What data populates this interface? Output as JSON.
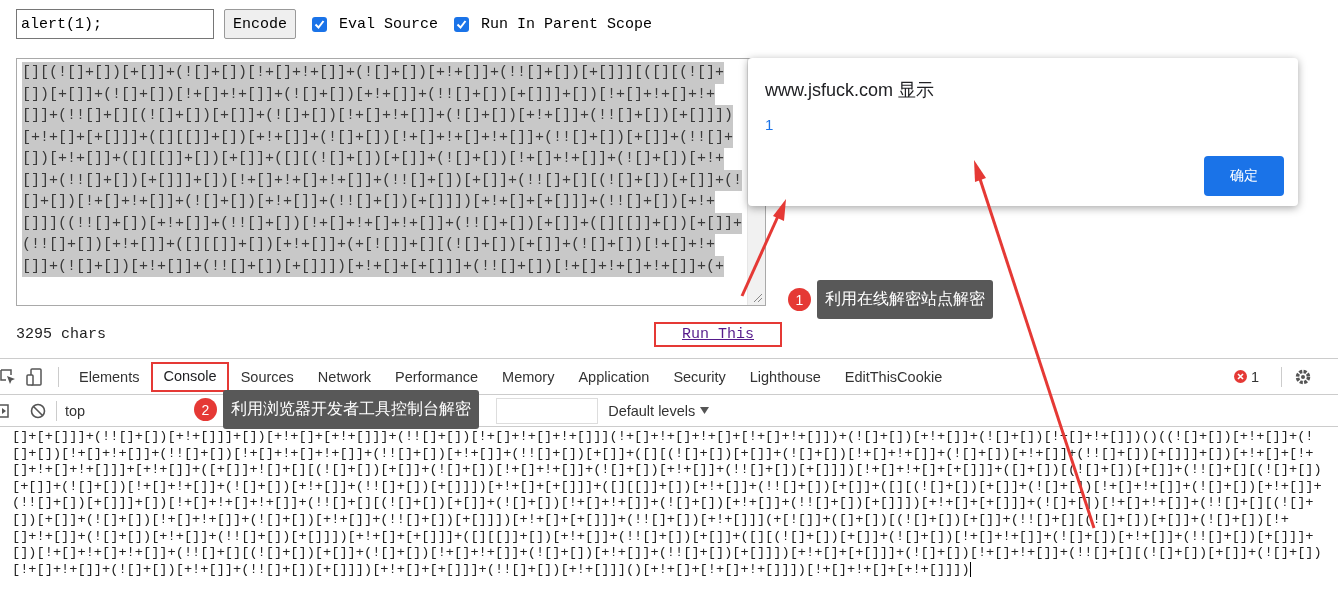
{
  "input": {
    "value": "alert(1);"
  },
  "encode_button": "Encode",
  "options": [
    {
      "label": "Eval Source",
      "checked": true
    },
    {
      "label": "Run In Parent Scope",
      "checked": true
    }
  ],
  "output_lines": [
    "[][(![]+[])[+[]]+(![]+[])[!+[]+!+[]]+(![]+[])[+!+[]]+(!![]+[])[+[]]][([][(![]+",
    "[])[+[]]+(![]+[])[!+[]+!+[]]+(![]+[])[+!+[]]+(!![]+[])[+[]]]+[])[!+[]+!+[]+!+",
    "[]]+(!![]+[][(![]+[])[+[]]+(![]+[])[!+[]+!+[]]+(![]+[])[+!+[]]+(!![]+[])[+[]]])",
    "[+!+[]+[+[]]]+([][[]]+[])[+!+[]]+(![]+[])[!+[]+!+[]+!+[]]+(!![]+[])[+[]]+(!![]+",
    "[])[+!+[]]+([][[]]+[])[+[]]+([][(![]+[])[+[]]+(![]+[])[!+[]+!+[]]+(![]+[])[+!+",
    "[]]+(!![]+[])[+[]]]+[])[!+[]+!+[]+!+[]]+(!![]+[])[+[]]+(!![]+[][(![]+[])[+[]]+(!",
    "[]+[])[!+[]+!+[]]+(![]+[])[+!+[]]+(!![]+[])[+[]]])[+!+[]+[+[]]]+(!![]+[])[+!+",
    "[]]]((!![]+[])[+!+[]]+(!![]+[])[!+[]+!+[]+!+[]]+(!![]+[])[+[]]+([][[]]+[])[+[]]+",
    "(!![]+[])[+!+[]]+([][[]]+[])[+!+[]]+(+[![]]+[][(![]+[])[+[]]+(![]+[])[!+[]+!+",
    "[]]+(![]+[])[+!+[]]+(!![]+[])[+[]]])[+!+[]+[+[]]]+(!![]+[])[!+[]+!+[]+!+[]]+(+"
  ],
  "char_count": "3295 chars",
  "run_link": {
    "label": "Run This",
    "highlighted": true
  },
  "alert": {
    "title": "www.jsfuck.com 显示",
    "message": "1",
    "button": "确定"
  },
  "devtools": {
    "tabs": [
      {
        "label": "Elements",
        "selected": false,
        "highlighted": false
      },
      {
        "label": "Console",
        "selected": true,
        "highlighted": true
      },
      {
        "label": "Sources",
        "selected": false,
        "highlighted": false
      },
      {
        "label": "Network",
        "selected": false,
        "highlighted": false
      },
      {
        "label": "Performance",
        "selected": false,
        "highlighted": false
      },
      {
        "label": "Memory",
        "selected": false,
        "highlighted": false
      },
      {
        "label": "Application",
        "selected": false,
        "highlighted": false
      },
      {
        "label": "Security",
        "selected": false,
        "highlighted": false
      },
      {
        "label": "Lighthouse",
        "selected": false,
        "highlighted": false
      },
      {
        "label": "EditThisCookie",
        "selected": false,
        "highlighted": false
      }
    ],
    "error_count": "1",
    "context": "top",
    "levels": "Default levels"
  },
  "console_lines": [
    "[]+[+[]]]+(!![]+[])[+!+[]]]+[])[+!+[]+[+!+[]]]+(!![]+[])[!+[]+!+[]+!+[]]](!+[]+!+[]+!+[]+[!+[]+!+[]])+(![]+[])[+!+[]]+(![]+[])[!+[]+!+[]])()((![]+[])[+!+[]]+(!",
    "[]+[])[!+[]+!+[]]+(!![]+[])[!+[]+!+[]+!+[]]+(!![]+[])[+!+[]]+(!![]+[])[+[]]+([][(![]+[])[+[]]+(![]+[])[!+[]+!+[]]+(![]+[])[+!+[]]+(!![]+[])[+[]]]+[])[+!+[]+[!+",
    "[]+!+[]+!+[]]]+[+!+[]]+([+[]]+![]+[][(![]+[])[+[]]+(![]+[])[!+[]+!+[]]+(![]+[])[+!+[]]+(!![]+[])[+[]]])[!+[]+!+[]+[+[]]]+([]+[])[(![]+[])[+[]]+(!![]+[][(![]+[])",
    "[+[]]+(![]+[])[!+[]+!+[]]+(![]+[])[+!+[]]+(!![]+[])[+[]]])[+!+[]+[+[]]]+([][[]]+[])[+!+[]]+(!![]+[])[+[]]+([][(![]+[])[+[]]+(![]+[])[!+[]+!+[]]+(![]+[])[+!+[]]+",
    "(!![]+[])[+[]]]+[])[!+[]+!+[]+!+[]]+(!![]+[][(![]+[])[+[]]+(![]+[])[!+[]+!+[]]+(![]+[])[+!+[]]+(!![]+[])[+[]]])[+!+[]+[+[]]]+(![]+[])[!+[]+!+[]]+(!![]+[][(![]+",
    "[])[+[]]+(![]+[])[!+[]+!+[]]+(![]+[])[+!+[]]+(!![]+[])[+[]]])[+!+[]+[+[]]]+(!![]+[])[+!+[]]](+[![]]+([]+[])[(![]+[])[+[]]+(!![]+[][(![]+[])[+[]]+(![]+[])[!+",
    "[]+!+[]]+(![]+[])[+!+[]]+(!![]+[])[+[]]])[+!+[]+[+[]]]+([][[]]+[])[+!+[]]+(!![]+[])[+[]]+([][(![]+[])[+[]]+(![]+[])[!+[]+!+[]]+(![]+[])[+!+[]]+(!![]+[])[+[]]]+",
    "[])[!+[]+!+[]+!+[]]+(!![]+[][(![]+[])[+[]]+(![]+[])[!+[]+!+[]]+(![]+[])[+!+[]]+(!![]+[])[+[]]])[+!+[]+[+[]]]+(![]+[])[!+[]+!+[]]+(!![]+[][(![]+[])[+[]]+(![]+[])",
    "[!+[]+!+[]]+(![]+[])[+!+[]]+(!![]+[])[+[]]])[+!+[]+[+[]]]+(!![]+[])[+!+[]]]()[+!+[]+[!+[]+!+[]]])[!+[]+!+[]+[+!+[]]])"
  ],
  "annotations": [
    {
      "number": "1",
      "text": "利用在线解密站点解密"
    },
    {
      "number": "2",
      "text": "利用浏览器开发者工具控制台解密"
    }
  ]
}
